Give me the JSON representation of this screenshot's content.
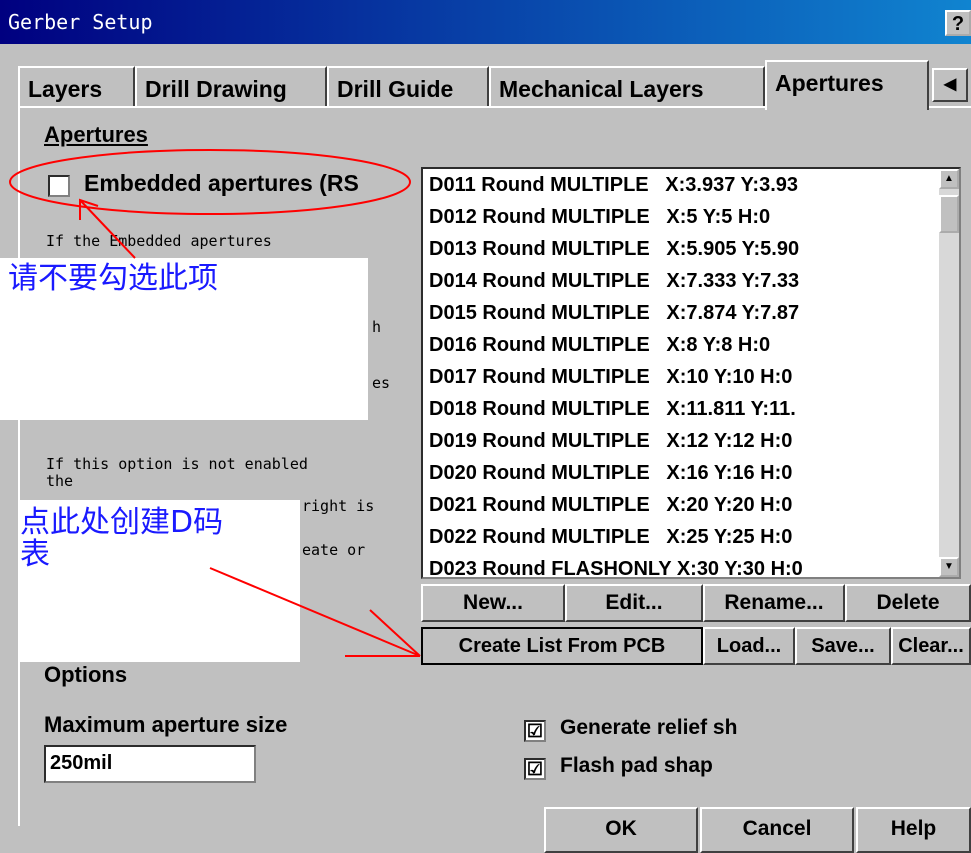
{
  "window": {
    "title": "Gerber Setup",
    "help_glyph": "?"
  },
  "tabs": [
    {
      "label": "Layers"
    },
    {
      "label": "Drill Drawing"
    },
    {
      "label": "Drill Guide"
    },
    {
      "label": "Mechanical Layers"
    },
    {
      "label": "Apertures"
    }
  ],
  "tab_scroll_left": "◀",
  "apertures": {
    "group_label": "Apertures",
    "embedded_checkbox_label": "Embedded apertures (RS",
    "description": [
      "If the Embedded apertures",
      "h",
      "es",
      "If this option is not enabled",
      "the",
      "right is",
      "eate or"
    ],
    "list_items": [
      "D011 Round MULTIPLE   X:3.937 Y:3.93",
      "D012 Round MULTIPLE   X:5 Y:5 H:0",
      "D013 Round MULTIPLE   X:5.905 Y:5.90",
      "D014 Round MULTIPLE   X:7.333 Y:7.33",
      "D015 Round MULTIPLE   X:7.874 Y:7.87",
      "D016 Round MULTIPLE   X:8 Y:8 H:0",
      "D017 Round MULTIPLE   X:10 Y:10 H:0",
      "D018 Round MULTIPLE   X:11.811 Y:11.",
      "D019 Round MULTIPLE   X:12 Y:12 H:0",
      "D020 Round MULTIPLE   X:16 Y:16 H:0",
      "D021 Round MULTIPLE   X:20 Y:20 H:0",
      "D022 Round MULTIPLE   X:25 Y:25 H:0",
      "D023 Round FLASHONLY X:30 Y:30 H:0"
    ],
    "buttons": {
      "new": "New...",
      "edit": "Edit...",
      "rename": "Rename...",
      "delete": "Delete",
      "create_list": "Create List From PCB",
      "load": "Load...",
      "save": "Save...",
      "clear": "Clear..."
    }
  },
  "options": {
    "group_label": "Options",
    "max_aperture_label": "Maximum aperture size",
    "max_aperture_value": "250mil",
    "generate_relief_label": "Generate relief sh",
    "flash_pad_label": "Flash pad shap",
    "checked_glyph": "☑"
  },
  "annotations": {
    "note1": "请不要勾选此项",
    "note2_line1": "点此处创建D码",
    "note2_line2": "表",
    "color": "#ff0000"
  },
  "footer": {
    "ok": "OK",
    "cancel": "Cancel",
    "help": "Help"
  }
}
